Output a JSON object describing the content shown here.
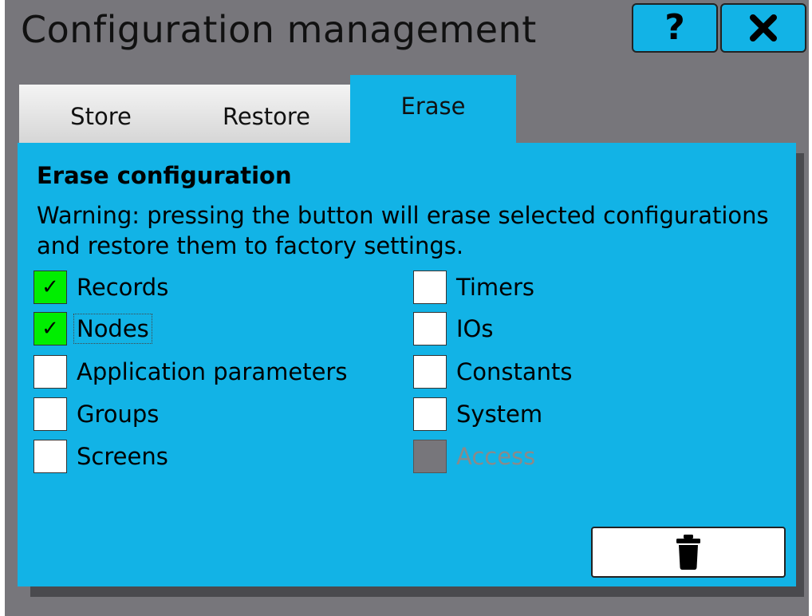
{
  "window": {
    "title": "Configuration management",
    "help_label": "?"
  },
  "tabs": [
    {
      "label": "Store",
      "active": false
    },
    {
      "label": "Restore",
      "active": false
    },
    {
      "label": "Erase",
      "active": true
    }
  ],
  "panel": {
    "heading": "Erase configuration",
    "warning": "Warning: pressing the button will erase selected configurations and restore them to factory settings."
  },
  "options": {
    "left": [
      {
        "label": "Records",
        "checked": true,
        "enabled": true
      },
      {
        "label": "Nodes",
        "checked": true,
        "enabled": true,
        "focused": true
      },
      {
        "label": "Application parameters",
        "checked": false,
        "enabled": true
      },
      {
        "label": "Groups",
        "checked": false,
        "enabled": true
      },
      {
        "label": "Screens",
        "checked": false,
        "enabled": true
      }
    ],
    "right": [
      {
        "label": "Timers",
        "checked": false,
        "enabled": true
      },
      {
        "label": "IOs",
        "checked": false,
        "enabled": true
      },
      {
        "label": "Constants",
        "checked": false,
        "enabled": true
      },
      {
        "label": "System",
        "checked": false,
        "enabled": true
      },
      {
        "label": "Access",
        "checked": false,
        "enabled": false
      }
    ]
  },
  "check_glyph": "✓",
  "icons": {
    "help": "question-mark-icon",
    "close": "close-icon",
    "erase": "trash-icon"
  },
  "colors": {
    "accent": "#12b3e6",
    "checked": "#00ee00",
    "background": "#77767b",
    "disabled": "#77767b"
  }
}
